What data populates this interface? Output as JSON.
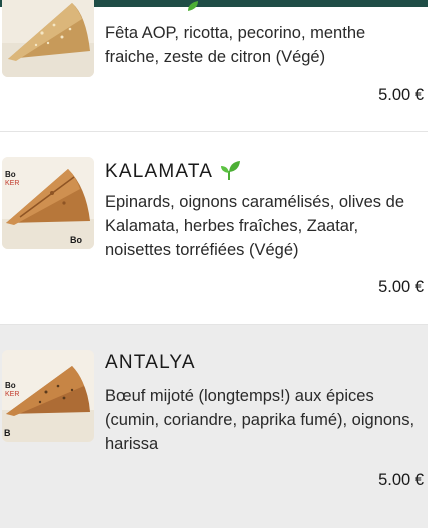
{
  "colors": {
    "accent_bar": "#1f4d46",
    "veg_leaf": "#4caf35",
    "highlight_bg": "#ececec"
  },
  "items": [
    {
      "name": "",
      "description": "Fêta AOP, ricotta, pecorino, menthe fraiche, zeste de citron (Végé)",
      "price": "5.00 €",
      "veg_icon": "leaf-icon"
    },
    {
      "name": "KALAMATA",
      "description": "Epinards, oignons caramélisés, olives de Kalamata, herbes fraîches, Zaatar, noisettes torréfiées (Végé)",
      "price": "5.00 €",
      "veg_icon": "leaf-icon"
    },
    {
      "name": "ANTALYA",
      "description": "Bœuf mijoté (longtemps!) aux épices (cumin, coriandre, paprika fumé), oignons, harissa",
      "price": "5.00 €"
    }
  ]
}
